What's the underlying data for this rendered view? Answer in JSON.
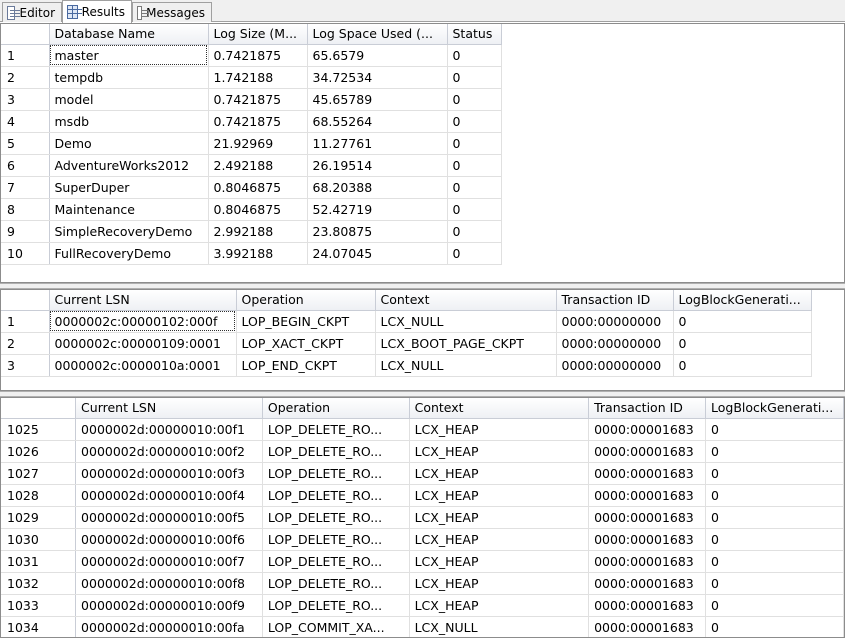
{
  "tabs": [
    {
      "label": "Editor",
      "icon": "editor-icon"
    },
    {
      "label": "Results",
      "icon": "grid-icon",
      "active": true
    },
    {
      "label": "Messages",
      "icon": "messages-icon"
    }
  ],
  "grid1": {
    "columns": [
      "Database Name",
      "Log Size (M...",
      "Log Space Used (...",
      "Status"
    ],
    "rows": [
      {
        "n": "1",
        "cells": [
          "master",
          "0.7421875",
          "65.6579",
          "0"
        ]
      },
      {
        "n": "2",
        "cells": [
          "tempdb",
          "1.742188",
          "34.72534",
          "0"
        ]
      },
      {
        "n": "3",
        "cells": [
          "model",
          "0.7421875",
          "45.65789",
          "0"
        ]
      },
      {
        "n": "4",
        "cells": [
          "msdb",
          "0.7421875",
          "68.55264",
          "0"
        ]
      },
      {
        "n": "5",
        "cells": [
          "Demo",
          "21.92969",
          "11.27761",
          "0"
        ]
      },
      {
        "n": "6",
        "cells": [
          "AdventureWorks2012",
          "2.492188",
          "26.19514",
          "0"
        ]
      },
      {
        "n": "7",
        "cells": [
          "SuperDuper",
          "0.8046875",
          "68.20388",
          "0"
        ]
      },
      {
        "n": "8",
        "cells": [
          "Maintenance",
          "0.8046875",
          "52.42719",
          "0"
        ]
      },
      {
        "n": "9",
        "cells": [
          "SimpleRecoveryDemo",
          "2.992188",
          "23.80875",
          "0"
        ]
      },
      {
        "n": "10",
        "cells": [
          "FullRecoveryDemo",
          "3.992188",
          "24.07045",
          "0"
        ]
      }
    ]
  },
  "grid2": {
    "columns": [
      "Current LSN",
      "Operation",
      "Context",
      "Transaction ID",
      "LogBlockGenerati..."
    ],
    "rows": [
      {
        "n": "1",
        "cells": [
          "0000002c:00000102:000f",
          "LOP_BEGIN_CKPT",
          "LCX_NULL",
          "0000:00000000",
          "0"
        ]
      },
      {
        "n": "2",
        "cells": [
          "0000002c:00000109:0001",
          "LOP_XACT_CKPT",
          "LCX_BOOT_PAGE_CKPT",
          "0000:00000000",
          "0"
        ]
      },
      {
        "n": "3",
        "cells": [
          "0000002c:0000010a:0001",
          "LOP_END_CKPT",
          "LCX_NULL",
          "0000:00000000",
          "0"
        ]
      }
    ]
  },
  "grid3": {
    "columns": [
      "Current LSN",
      "Operation",
      "Context",
      "Transaction ID",
      "LogBlockGenerati..."
    ],
    "rows": [
      {
        "n": "1025",
        "cells": [
          "0000002d:00000010:00f1",
          "LOP_DELETE_RO...",
          "LCX_HEAP",
          "0000:00001683",
          "0"
        ]
      },
      {
        "n": "1026",
        "cells": [
          "0000002d:00000010:00f2",
          "LOP_DELETE_RO...",
          "LCX_HEAP",
          "0000:00001683",
          "0"
        ]
      },
      {
        "n": "1027",
        "cells": [
          "0000002d:00000010:00f3",
          "LOP_DELETE_RO...",
          "LCX_HEAP",
          "0000:00001683",
          "0"
        ]
      },
      {
        "n": "1028",
        "cells": [
          "0000002d:00000010:00f4",
          "LOP_DELETE_RO...",
          "LCX_HEAP",
          "0000:00001683",
          "0"
        ]
      },
      {
        "n": "1029",
        "cells": [
          "0000002d:00000010:00f5",
          "LOP_DELETE_RO...",
          "LCX_HEAP",
          "0000:00001683",
          "0"
        ]
      },
      {
        "n": "1030",
        "cells": [
          "0000002d:00000010:00f6",
          "LOP_DELETE_RO...",
          "LCX_HEAP",
          "0000:00001683",
          "0"
        ]
      },
      {
        "n": "1031",
        "cells": [
          "0000002d:00000010:00f7",
          "LOP_DELETE_RO...",
          "LCX_HEAP",
          "0000:00001683",
          "0"
        ]
      },
      {
        "n": "1032",
        "cells": [
          "0000002d:00000010:00f8",
          "LOP_DELETE_RO...",
          "LCX_HEAP",
          "0000:00001683",
          "0"
        ]
      },
      {
        "n": "1033",
        "cells": [
          "0000002d:00000010:00f9",
          "LOP_DELETE_RO...",
          "LCX_HEAP",
          "0000:00001683",
          "0"
        ]
      },
      {
        "n": "1034",
        "cells": [
          "0000002d:00000010:00fa",
          "LOP_COMMIT_XA...",
          "LCX_NULL",
          "0000:00001683",
          "0"
        ]
      }
    ]
  }
}
